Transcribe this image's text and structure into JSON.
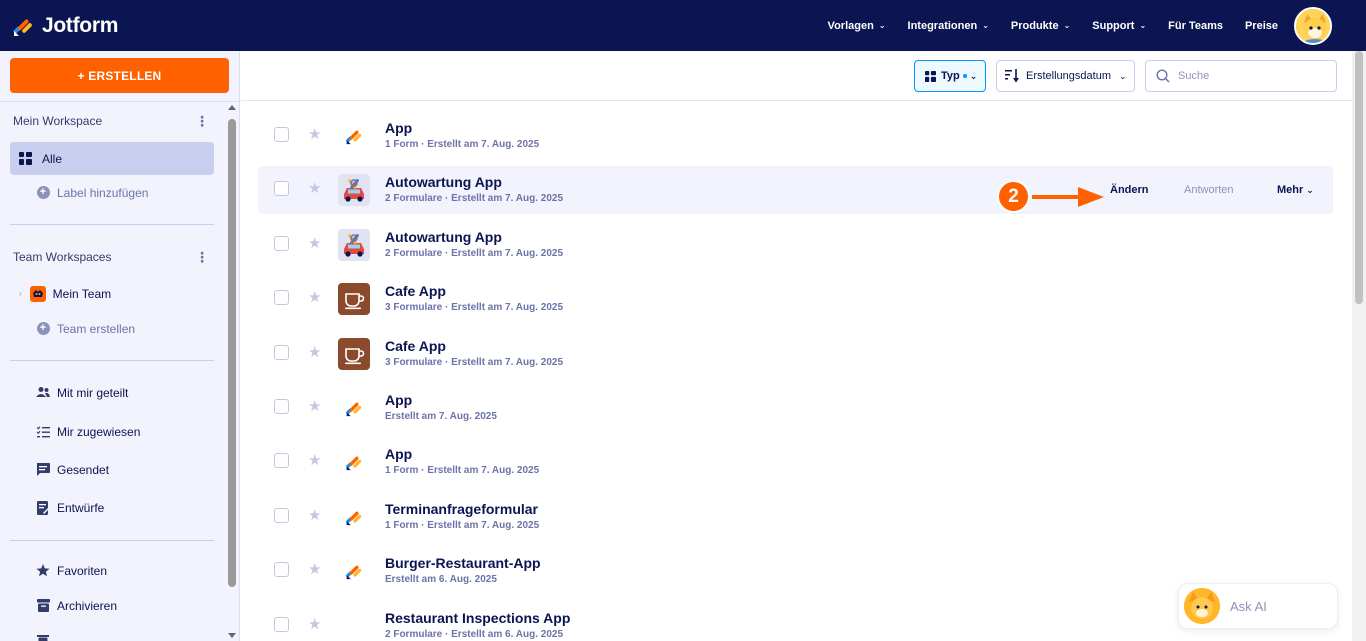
{
  "header": {
    "logo_text": "Jotform",
    "nav": [
      "Vorlagen",
      "Integrationen",
      "Produkte",
      "Support",
      "Für Teams",
      "Preise"
    ],
    "nav_dropdown": [
      true,
      true,
      true,
      true,
      false,
      false
    ]
  },
  "sidebar": {
    "create_label": "+ ERSTELLEN",
    "workspace_title": "Mein Workspace",
    "all_label": "Alle",
    "add_label": "Label hinzufügen",
    "team_title": "Team Workspaces",
    "team_name": "Mein Team",
    "team_create": "Team erstellen",
    "shared": "Mit mir geteilt",
    "assigned": "Mir zugewiesen",
    "sent": "Gesendet",
    "drafts": "Entwürfe",
    "favorites": "Favoriten",
    "archive": "Archivieren"
  },
  "toolbar": {
    "type_label": "Typ",
    "sort_label": "Erstellungsdatum",
    "search_placeholder": "Suche"
  },
  "rows": [
    {
      "title": "App",
      "meta": "1 Form · Erstellt am 7. Aug. 2025",
      "icon": "jotform-logo-icon"
    },
    {
      "title": "Autowartung App",
      "meta": "2 Formulare · Erstellt am 7. Aug. 2025",
      "icon": "car-wrench-icon"
    },
    {
      "title": "Autowartung App",
      "meta": "2 Formulare · Erstellt am 7. Aug. 2025",
      "icon": "car-wrench-icon"
    },
    {
      "title": "Cafe App",
      "meta": "3 Formulare · Erstellt am 7. Aug. 2025",
      "icon": "coffee-cup-icon"
    },
    {
      "title": "Cafe App",
      "meta": "3 Formulare · Erstellt am 7. Aug. 2025",
      "icon": "coffee-cup-icon"
    },
    {
      "title": "App",
      "meta": "Erstellt am 7. Aug. 2025",
      "icon": "jotform-logo-icon"
    },
    {
      "title": "App",
      "meta": "1 Form · Erstellt am 7. Aug. 2025",
      "icon": "jotform-logo-icon"
    },
    {
      "title": "Terminanfrageformular",
      "meta": "1 Form · Erstellt am 7. Aug. 2025",
      "icon": "jotform-logo-icon"
    },
    {
      "title": "Burger-Restaurant-App",
      "meta": "Erstellt am 6. Aug. 2025",
      "icon": "jotform-logo-icon"
    },
    {
      "title": "Restaurant Inspections App",
      "meta": "2 Formulare · Erstellt am 6. Aug. 2025",
      "icon": "none"
    }
  ],
  "row_actions": {
    "edit": "Ändern",
    "responses": "Antworten",
    "more": "Mehr"
  },
  "step_badge": "2",
  "ask_ai": "Ask AI",
  "colors": {
    "navy": "#0a1551",
    "orange": "#ff6100",
    "blue": "#0099ff",
    "sidebar_bg": "#f3f3fe"
  }
}
